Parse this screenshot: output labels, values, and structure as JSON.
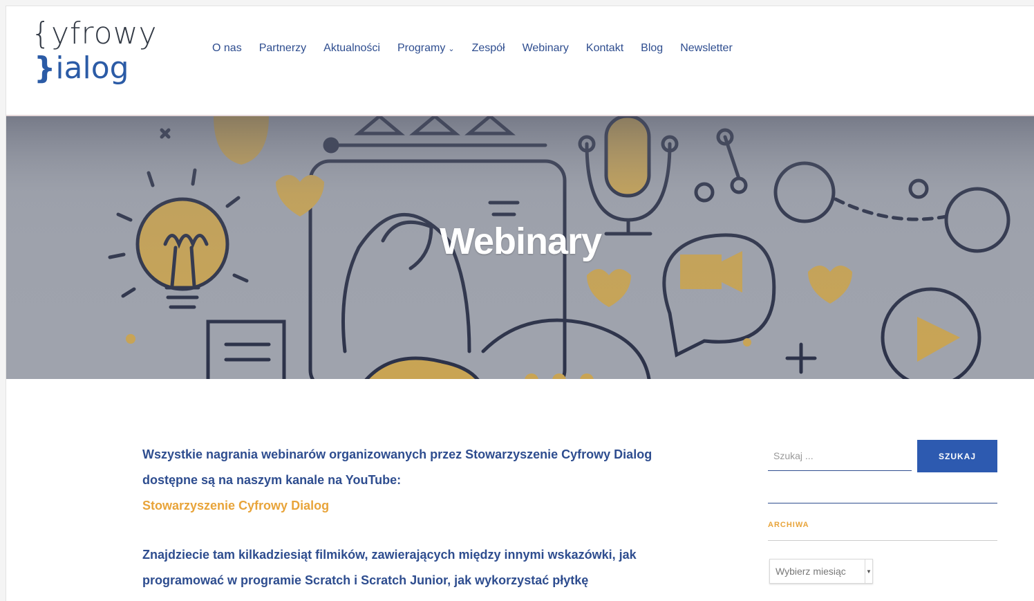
{
  "brand": {
    "logo_line1_brace": "{",
    "logo_line1_text": "yfrowy",
    "logo_line2_brace": "}",
    "logo_line2_text": "ialog"
  },
  "nav": {
    "items": [
      {
        "label": "O nas"
      },
      {
        "label": "Partnerzy"
      },
      {
        "label": "Aktualności"
      },
      {
        "label": "Programy",
        "has_dropdown": true
      },
      {
        "label": "Zespół"
      },
      {
        "label": "Webinary"
      },
      {
        "label": "Kontakt"
      },
      {
        "label": "Blog"
      },
      {
        "label": "Newsletter"
      }
    ],
    "dropdown_icon": "⌄"
  },
  "hero": {
    "title": "Webinary"
  },
  "content": {
    "p1_line1": "Wszystkie nagrania webinarów organizowanych przez Stowarzyszenie Cyfrowy Dialog",
    "p1_line2": "dostępne są na naszym kanale na YouTube:",
    "link": "Stowarzyszenie Cyfrowy Dialog",
    "p2_line1": "Znajdziecie tam kilkadziesiąt filmików, zawierających między innymi wskazówki, jak",
    "p2_line2": "programować w programie Scratch i Scratch Junior, jak wykorzystać płytkę"
  },
  "sidebar": {
    "search_placeholder": "Szukaj ...",
    "search_button": "SZUKAJ",
    "archive_title": "ARCHIWA",
    "archive_select": "Wybierz miesiąc"
  },
  "colors": {
    "primary": "#2e4d8f",
    "button": "#2d5ab0",
    "accent": "#e8a43a",
    "hero_bg": "#9fa3ad",
    "illustration_ink": "#2b3148",
    "illustration_gold": "#c9a453"
  }
}
